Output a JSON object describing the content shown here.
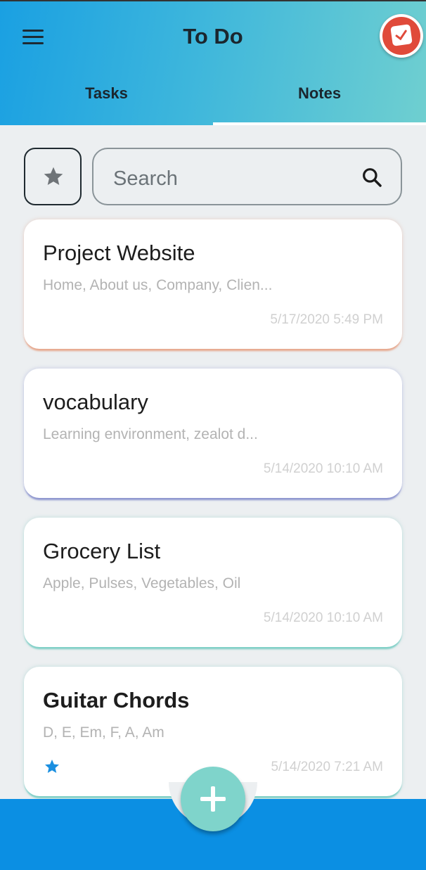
{
  "header": {
    "title": "To Do",
    "menu_icon": "hamburger-menu-icon",
    "logo_icon": "todo-app-logo-icon",
    "gradient": [
      "#1aa0e2",
      "#6fcfd0"
    ]
  },
  "tabs": [
    {
      "label": "Tasks",
      "selected": false
    },
    {
      "label": "Notes",
      "selected": true
    }
  ],
  "search": {
    "placeholder": "Search",
    "value": "",
    "icon": "search-icon",
    "favorite_filter_icon": "star-icon"
  },
  "notes": [
    {
      "title": "Project Website",
      "preview": "Home, About us, Company, Clien...",
      "date": "5/17/2020 5:49 PM",
      "accent": "#e7a98f",
      "favorite": false,
      "bold": false
    },
    {
      "title": "vocabulary",
      "preview": "Learning environment, zealot d...",
      "date": "5/14/2020 10:10 AM",
      "accent": "#8e96cf",
      "favorite": false,
      "bold": false
    },
    {
      "title": "Grocery List",
      "preview": "Apple, Pulses, Vegetables, Oil",
      "date": "5/14/2020 10:10 AM",
      "accent": "#7ecfc6",
      "favorite": false,
      "bold": false
    },
    {
      "title": "Guitar Chords",
      "preview": "D, E, Em, F, A, Am",
      "date": "5/14/2020 7:21 AM",
      "accent": "#7ecfc6",
      "favorite": true,
      "bold": true
    }
  ],
  "fab": {
    "icon": "plus-icon",
    "color": "#7fd4cb"
  },
  "bottom_bar": {
    "color": "#0b8fe3"
  }
}
